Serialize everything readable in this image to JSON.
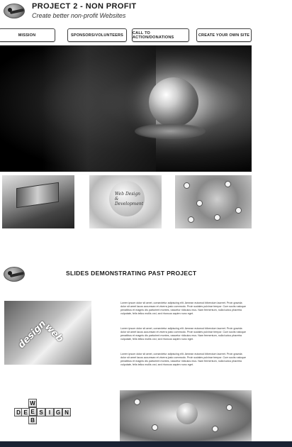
{
  "header": {
    "title": "PROJECT 2 - NON PROFIT",
    "subtitle": "Create better non-profit Websites",
    "logo_icon": "hawk-logo-icon"
  },
  "nav": {
    "items": [
      {
        "label": "MISSION"
      },
      {
        "label": "SPONSORS/VOLUNTEERS"
      },
      {
        "label": "CALL TO ACTION/DONATIONS"
      },
      {
        "label": "CREATE YOUR OWN SITE"
      }
    ]
  },
  "thumbnails": {
    "web_design_caption": "Web Design & Development"
  },
  "slides": {
    "heading": "SLIDES DEMONSTRATING PAST PROJECT",
    "gear_words": [
      "design",
      "web"
    ],
    "cube_letters": [
      "W",
      "E",
      "B",
      "D",
      "E",
      "S",
      "I",
      "G",
      "N"
    ],
    "paragraphs": [
      "Lorem ipsum dolor sit amet, consectetur adipiscing elit. Aenean euismod bibendum laoreet. Proin gravida dolor sit amet lacus accumsan et viverra justo commodo. Proin sodales pulvinar tempor. Cum sociis natoque penatibus et magnis dis parturient montes, nascetur ridiculus mus. Nam fermentum, nulla luctus pharetra vulputate, felis tellus mollis orci, sed rhoncus sapien nunc eget.",
      "Lorem ipsum dolor sit amet, consectetur adipiscing elit. Aenean euismod bibendum laoreet. Proin gravida dolor sit amet lacus accumsan et viverra justo commodo. Proin sodales pulvinar tempor. Cum sociis natoque penatibus et magnis dis parturient montes, nascetur ridiculus mus. Nam fermentum, nulla luctus pharetra vulputate, felis tellus mollis orci, sed rhoncus sapien nunc eget.",
      "Lorem ipsum dolor sit amet, consectetur adipiscing elit. Aenean euismod bibendum laoreet. Proin gravida dolor sit amet lacus accumsan et viverra justo commodo. Proin sodales pulvinar tempor. Cum sociis natoque penatibus et magnis dis parturient montes, nascetur ridiculus mus. Nam fermentum, nulla luctus pharetra vulputate, felis tellus mollis orci, sed rhoncus sapien nunc eget."
    ]
  },
  "colors": {
    "footer_bar": "#1a2233",
    "nav_border": "#444444"
  }
}
